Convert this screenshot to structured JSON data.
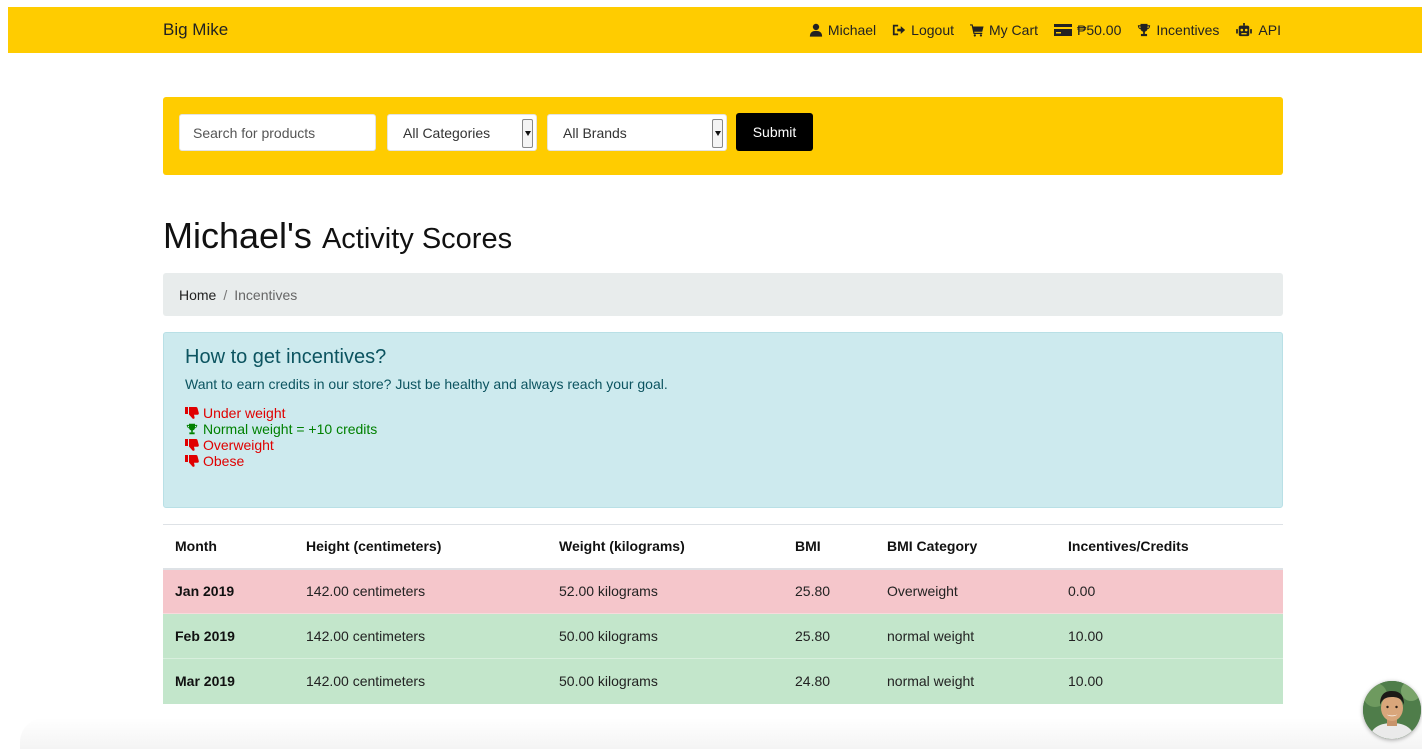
{
  "navbar": {
    "brand": "Big Mike",
    "links": {
      "user": "Michael",
      "logout": "Logout",
      "cart": "My Cart",
      "credits": "₱50.00",
      "incentives": "Incentives",
      "api": "API"
    }
  },
  "search": {
    "placeholder": "Search for products",
    "category_selected": "All Categories",
    "brand_selected": "All Brands",
    "submit_label": "Submit"
  },
  "page": {
    "title_name": "Michael's",
    "title_sub": "Activity Scores"
  },
  "breadcrumb": {
    "home": "Home",
    "separator": "/",
    "current": "Incentives"
  },
  "info": {
    "heading": "How to get incentives?",
    "text": "Want to earn credits in our store? Just be healthy and always reach your goal.",
    "rules": [
      {
        "label": "Under weight",
        "icon": "thumbs-down-icon",
        "color": "#e00000"
      },
      {
        "label": "Normal weight = +10 credits",
        "icon": "trophy-icon",
        "color": "#008000"
      },
      {
        "label": "Overweight",
        "icon": "thumbs-down-icon",
        "color": "#e00000"
      },
      {
        "label": "Obese",
        "icon": "thumbs-down-icon",
        "color": "#e00000"
      }
    ]
  },
  "table": {
    "headers": [
      "Month",
      "Height (centimeters)",
      "Weight (kilograms)",
      "BMI",
      "BMI Category",
      "Incentives/Credits"
    ],
    "rows": [
      [
        "Jan 2019",
        "142.00 centimeters",
        "52.00 kilograms",
        "25.80",
        "Overweight",
        "0.00"
      ],
      [
        "Feb 2019",
        "142.00 centimeters",
        "50.00 kilograms",
        "25.80",
        "normal weight",
        "10.00"
      ],
      [
        "Mar 2019",
        "142.00 centimeters",
        "50.00 kilograms",
        "24.80",
        "normal weight",
        "10.00"
      ]
    ],
    "row_colors": {
      "danger": "#f5c6cb",
      "success": "#c3e6cb"
    }
  },
  "colors": {
    "accent": "#ffcc00",
    "info_bg": "#cdeaee",
    "info_text": "#0c5460"
  }
}
